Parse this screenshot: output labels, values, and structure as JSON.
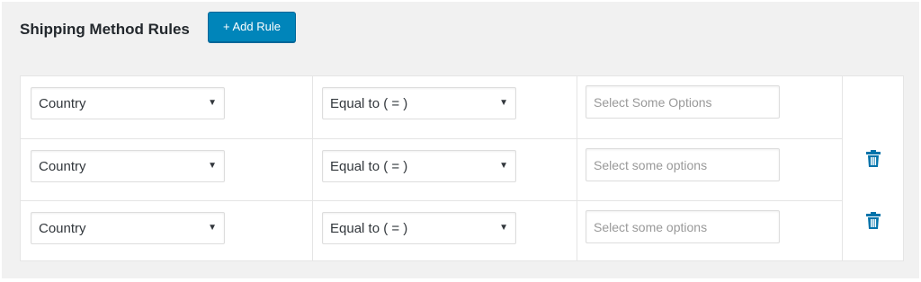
{
  "header": {
    "title": "Shipping Method Rules",
    "add_rule_label": "+ Add Rule"
  },
  "rules": [
    {
      "field": "Country",
      "operator": "Equal to ( = )",
      "value_placeholder": "Select Some Options",
      "has_delete": false
    },
    {
      "field": "Country",
      "operator": "Equal to ( = )",
      "value_placeholder": "Select some options",
      "has_delete": true
    },
    {
      "field": "Country",
      "operator": "Equal to ( = )",
      "value_placeholder": "Select some options",
      "has_delete": true
    }
  ],
  "icons": {
    "dropdown": "chevron-down-icon",
    "delete": "trash-icon"
  },
  "colors": {
    "accent": "#0085ba",
    "delete_icon": "#0073aa",
    "panel_bg": "#f1f1f1"
  }
}
